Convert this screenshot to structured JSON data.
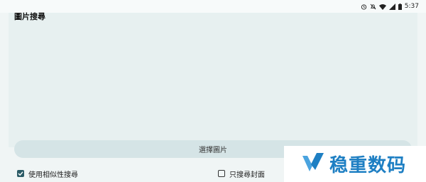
{
  "status_bar": {
    "time": "5:37",
    "icons": [
      "alarm-icon",
      "mute-icon",
      "wifi-icon",
      "signal-icon",
      "battery-icon"
    ]
  },
  "panel": {
    "title": "圖片搜尋"
  },
  "select_button": {
    "label": "選擇圖片"
  },
  "options": {
    "similarity": {
      "label": "使用相似性搜尋",
      "checked": true
    },
    "covers_only": {
      "label": "只搜尋封面",
      "checked": false
    }
  },
  "watermark": {
    "text": "稳重数码",
    "brand_color": "#1e7fc3"
  },
  "colors": {
    "accent": "#2b5b66",
    "button_bg": "#d5e4e6",
    "panel_bg": "#e7f0f0"
  }
}
